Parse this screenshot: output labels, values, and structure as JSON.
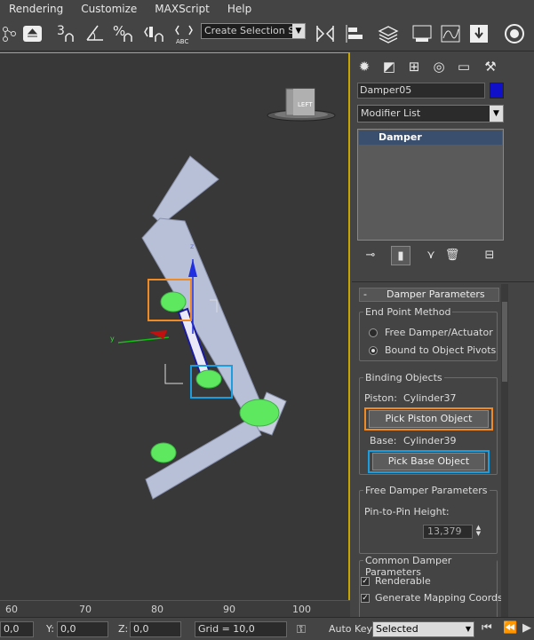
{
  "menu": {
    "items": [
      "Rendering",
      "Customize",
      "MAXScript",
      "Help"
    ]
  },
  "toolbar": {
    "selection_set_placeholder": "Create Selection Se",
    "icons": [
      "link-icon",
      "import-icon",
      "snap-3d-icon",
      "angle-snap-icon",
      "percent-snap-icon",
      "spinner-snap-icon",
      "edit-named-selection-icon",
      "mirror-icon",
      "align-icon",
      "layer-manager-icon",
      "schematic-view-icon",
      "curve-editor-icon",
      "material-editor-icon",
      "render-setup-icon",
      "rendered-frame-icon",
      "render-icon"
    ]
  },
  "viewport": {
    "viewcube_label": "LEFT",
    "axis_labels": {
      "z": "z",
      "y": "y"
    }
  },
  "ruler": {
    "labels": [
      "60",
      "70",
      "80",
      "90",
      "100"
    ]
  },
  "statusbar": {
    "x_value": "0,0",
    "y_label": "Y:",
    "y_value": "0,0",
    "z_label": "Z:",
    "z_value": "0,0",
    "grid_label": "Grid = 10,0",
    "auto_key_label": "Auto Key",
    "selected_value": "Selected"
  },
  "command_panel": {
    "tabs": [
      "create-icon",
      "modify-icon",
      "hierarchy-icon",
      "motion-icon",
      "display-icon",
      "utilities-icon"
    ],
    "object_name": "Damper05",
    "object_color": "#1010c8",
    "modifier_list_label": "Modifier List",
    "stack_items": [
      "Damper"
    ],
    "rollout": {
      "minus": "-",
      "title": "Damper Parameters",
      "end_point_group": "End Point Method",
      "radio_free": "Free Damper/Actuator",
      "radio_bound": "Bound to Object Pivots",
      "binding_group": "Binding Objects",
      "piston_label": "Piston:",
      "piston_value": "Cylinder37",
      "pick_piston": "Pick Piston Object",
      "base_label": "Base:",
      "base_value": "Cylinder39",
      "pick_base": "Pick Base Object",
      "free_group": "Free Damper Parameters",
      "pin_height_label": "Pin-to-Pin Height:",
      "pin_height_value": "13,379",
      "common_group": "Common Damper Parameters",
      "renderable_label": "Renderable",
      "mapping_label": "Generate Mapping Coords"
    }
  },
  "colors": {
    "highlight_orange": "#f08a24",
    "highlight_blue": "#1a9ee0",
    "viewport_border": "#c8a500"
  }
}
